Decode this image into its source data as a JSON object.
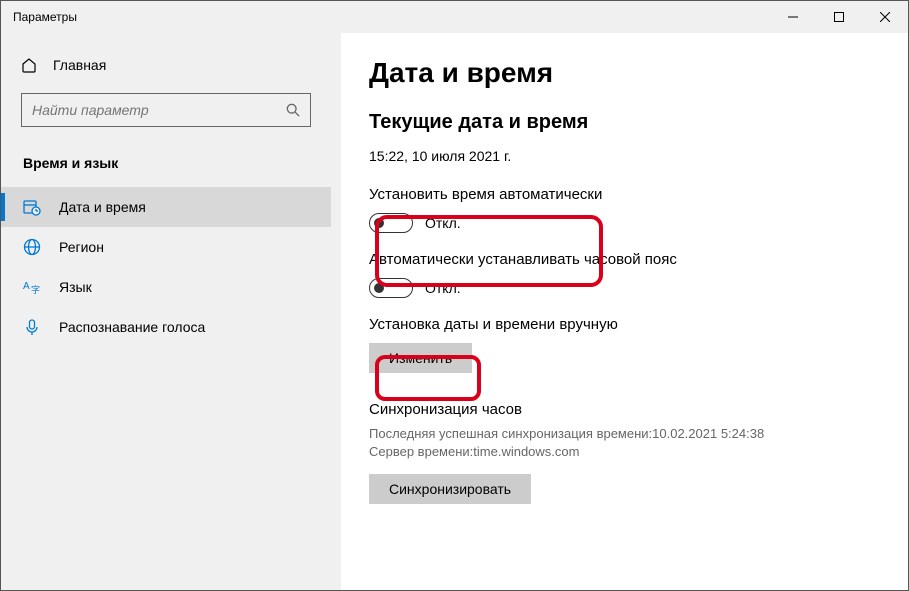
{
  "window": {
    "title": "Параметры"
  },
  "sidebar": {
    "home": "Главная",
    "search_placeholder": "Найти параметр",
    "section": "Время и язык",
    "items": [
      {
        "label": "Дата и время"
      },
      {
        "label": "Регион"
      },
      {
        "label": "Язык"
      },
      {
        "label": "Распознавание голоса"
      }
    ]
  },
  "content": {
    "title": "Дата и время",
    "current_heading": "Текущие дата и время",
    "current_value": "15:22, 10 июля 2021 г.",
    "auto_time_label": "Установить время автоматически",
    "auto_time_state": "Откл.",
    "auto_tz_label": "Автоматически устанавливать часовой пояс",
    "auto_tz_state": "Откл.",
    "manual_label": "Установка даты и времени вручную",
    "change_btn": "Изменить",
    "sync_heading": "Синхронизация часов",
    "sync_last": "Последняя успешная синхронизация времени:10.02.2021 5:24:38",
    "sync_server": "Сервер времени:time.windows.com",
    "sync_btn": "Синхронизировать"
  }
}
